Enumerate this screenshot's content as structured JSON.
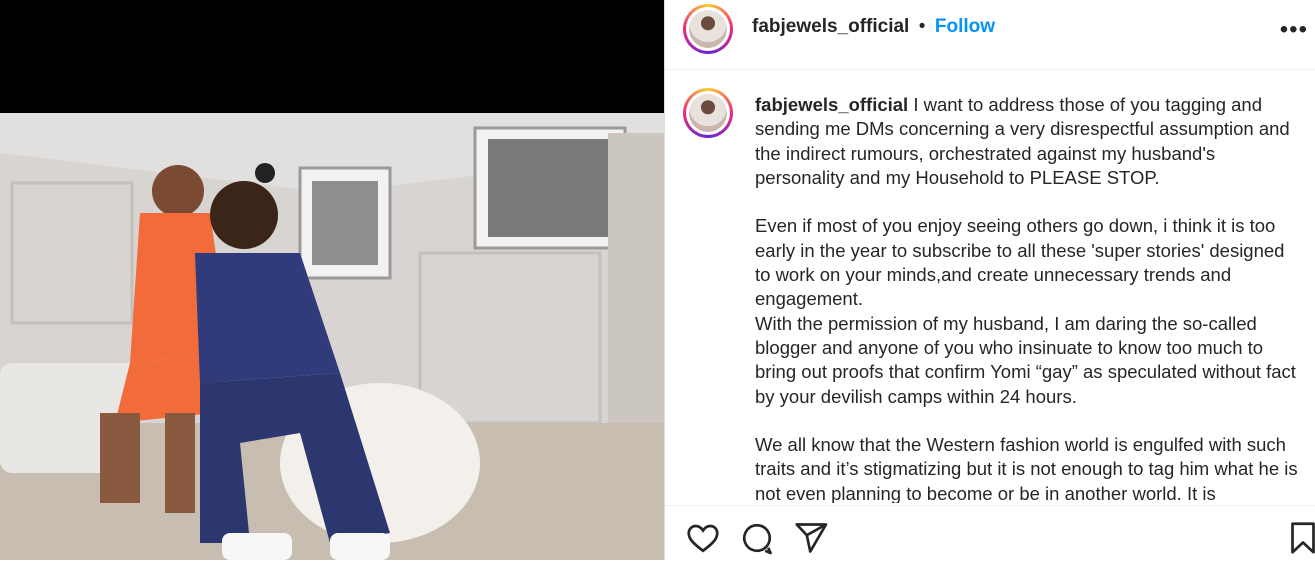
{
  "post": {
    "username": "fabjewels_official",
    "separator": "•",
    "follow_label": "Follow",
    "more_label": "•••"
  },
  "caption": {
    "username": "fabjewels_official",
    "paragraphs": [
      "I want to address those of you tagging and sending me DMs concerning a very disrespectful assumption and the indirect rumours, orchestrated against my husband's personality and my Household to PLEASE STOP.",
      "Even if most of you enjoy seeing others go down, i think it is too early in the year to subscribe to all these 'super stories' designed to work on your minds,and create unnecessary trends and engagement.",
      "With the permission of my husband, I am daring the so-called blogger and anyone of you who insinuate to know too much to bring out proofs that confirm Yomi “gay” as speculated without fact by your devilish camps within 24 hours.",
      "We all know that the Western fashion world is engulfed with such traits and it’s stigmatizing but it is not enough to tag him what he is not even planning to become or be in another world. It is"
    ]
  },
  "actions": {
    "icons": [
      "heart-icon",
      "comment-icon",
      "share-icon",
      "bookmark-icon"
    ]
  },
  "colors": {
    "follow": "#0095f6",
    "text": "#262626",
    "border": "#dbdbdb"
  }
}
